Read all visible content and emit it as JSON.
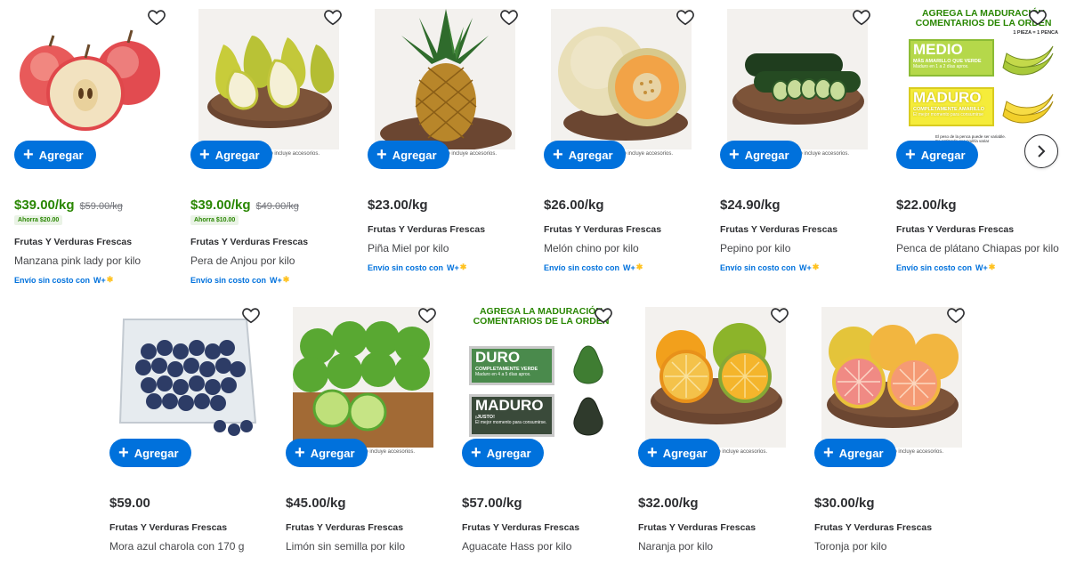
{
  "common": {
    "add_label": "Agregar",
    "category": "Frutas Y Verduras Frescas",
    "shipping_text": "Envío sin costo con",
    "wplus_label": "W+",
    "no_accessories": "no incluye accesorios."
  },
  "row1": [
    {
      "name": "Manzana pink lady por kilo",
      "price": "$39.00/kg",
      "was": "$59.00/kg",
      "badge": "Ahorra $20.00",
      "sale": true
    },
    {
      "name": "Pera de Anjou por kilo",
      "price": "$39.00/kg",
      "was": "$49.00/kg",
      "badge": "Ahorra $10.00",
      "sale": true
    },
    {
      "name": "Piña Miel por kilo",
      "price": "$23.00/kg"
    },
    {
      "name": "Melón chino por kilo",
      "price": "$26.00/kg"
    },
    {
      "name": "Pepino por kilo",
      "price": "$24.90/kg"
    },
    {
      "name": "Penca de plátano Chiapas por kilo",
      "price": "$22.00/kg"
    }
  ],
  "row2": [
    {
      "name": "Mora azul charola con 170 g",
      "price": "$59.00"
    },
    {
      "name": "Limón sin semilla por kilo",
      "price": "$45.00/kg"
    },
    {
      "name": "Aguacate Hass por kilo",
      "price": "$57.00/kg"
    },
    {
      "name": "Naranja por kilo",
      "price": "$32.00/kg"
    },
    {
      "name": "Toronja por kilo",
      "price": "$30.00/kg"
    }
  ],
  "promo_banana": {
    "title_line1": "AGREGA LA MADURACIÓN",
    "title_line2": "COMENTARIOS DE LA ORDEN",
    "subtitle": "1 PIEZA = 1 PENCA",
    "medio": "MEDIO",
    "medio_sub": "MÁS AMARILLO QUE VERDE",
    "medio_sub2": "Maduro en 1 a 2 días aprox.",
    "maduro": "MADURO",
    "maduro_sub": "COMPLETAMENTE AMARILLO",
    "maduro_sub2": "El mejor momento para consumirse",
    "footer1": "El peso de la penca puede ser variable.",
    "footer2": "Se estimado que podría variar",
    "footer3": "como la temperatura."
  },
  "promo_avocado": {
    "title_line1": "AGREGA LA MADURACIÓN",
    "title_line2": "COMENTARIOS DE LA ORDEN",
    "duro": "DURO",
    "duro_sub": "COMPLETAMENTE VERDE",
    "duro_sub2": "Maduro en 4 a 5 días aprox.",
    "maduro": "MADURO",
    "maduro_sub": "¡JUSTO!",
    "maduro_sub2": "El mejor momento para consumirse."
  },
  "colors": {
    "primary_blue": "#0071dc",
    "sale_green": "#2a8703",
    "text_dark": "#2e2f32"
  },
  "icons": {
    "heart": "heart-icon",
    "plus": "plus-icon",
    "next": "chevron-right-icon"
  }
}
